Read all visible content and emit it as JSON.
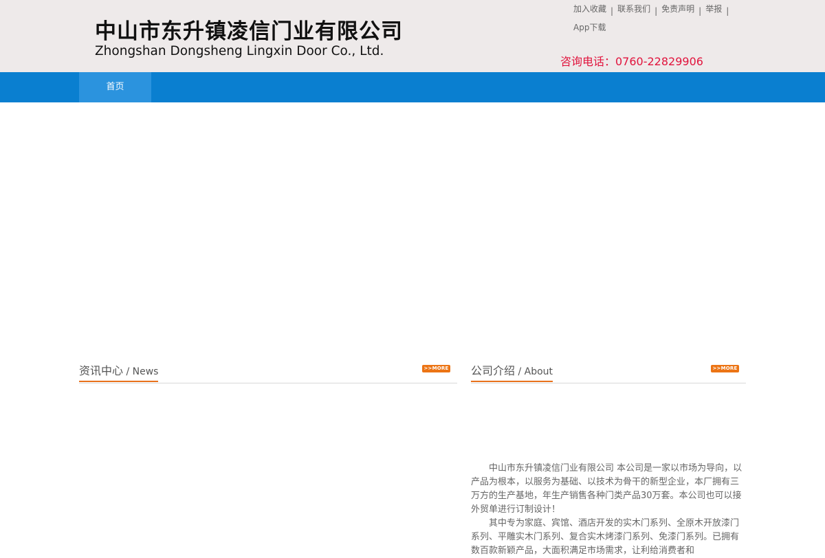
{
  "header": {
    "logo_cn": "中山市东升镇凌信门业有限公司",
    "logo_en": "Zhongshan Dongsheng Lingxin Door Co., Ltd.",
    "top_links": [
      {
        "label": "加入收藏"
      },
      {
        "label": "联系我们"
      },
      {
        "label": "免责声明"
      },
      {
        "label": "举报"
      },
      {
        "label": "App下载"
      }
    ],
    "separator": "|",
    "hotline": "咨询电话：0760-22829906"
  },
  "nav": {
    "items": [
      {
        "label": "首页"
      }
    ]
  },
  "sections": {
    "news": {
      "title_cn": "资讯中心",
      "title_en": " / News",
      "more_label": ">>MORE"
    },
    "about": {
      "title_cn": "公司介绍",
      "title_en": " / About",
      "more_label": ">>MORE"
    }
  },
  "about": {
    "paragraphs": [
      "中山市东升镇凌信门业有限公司 本公司是一家以市场为导向，以产品为根本，以服务为基础、以技术为骨干的新型企业，本厂拥有三万方的生产基地，年生产销售各种门类产品30万套。本公司也可以接外贸单进行订制设计！",
      "其中专为家庭、宾馆、酒店开发的实木门系列、全原木开放漆门系列、平雕实木门系列、复合实木烤漆门系列、免漆门系列。已拥有数百款新颖产品，大面积满足市场需求，让利给消费者和"
    ]
  },
  "colors": {
    "header_bg": "#eeeaea",
    "nav_bg": "#0a7fd0",
    "nav_active": "#2b93de",
    "hotline": "#e1133c",
    "accent": "#e8711a"
  }
}
